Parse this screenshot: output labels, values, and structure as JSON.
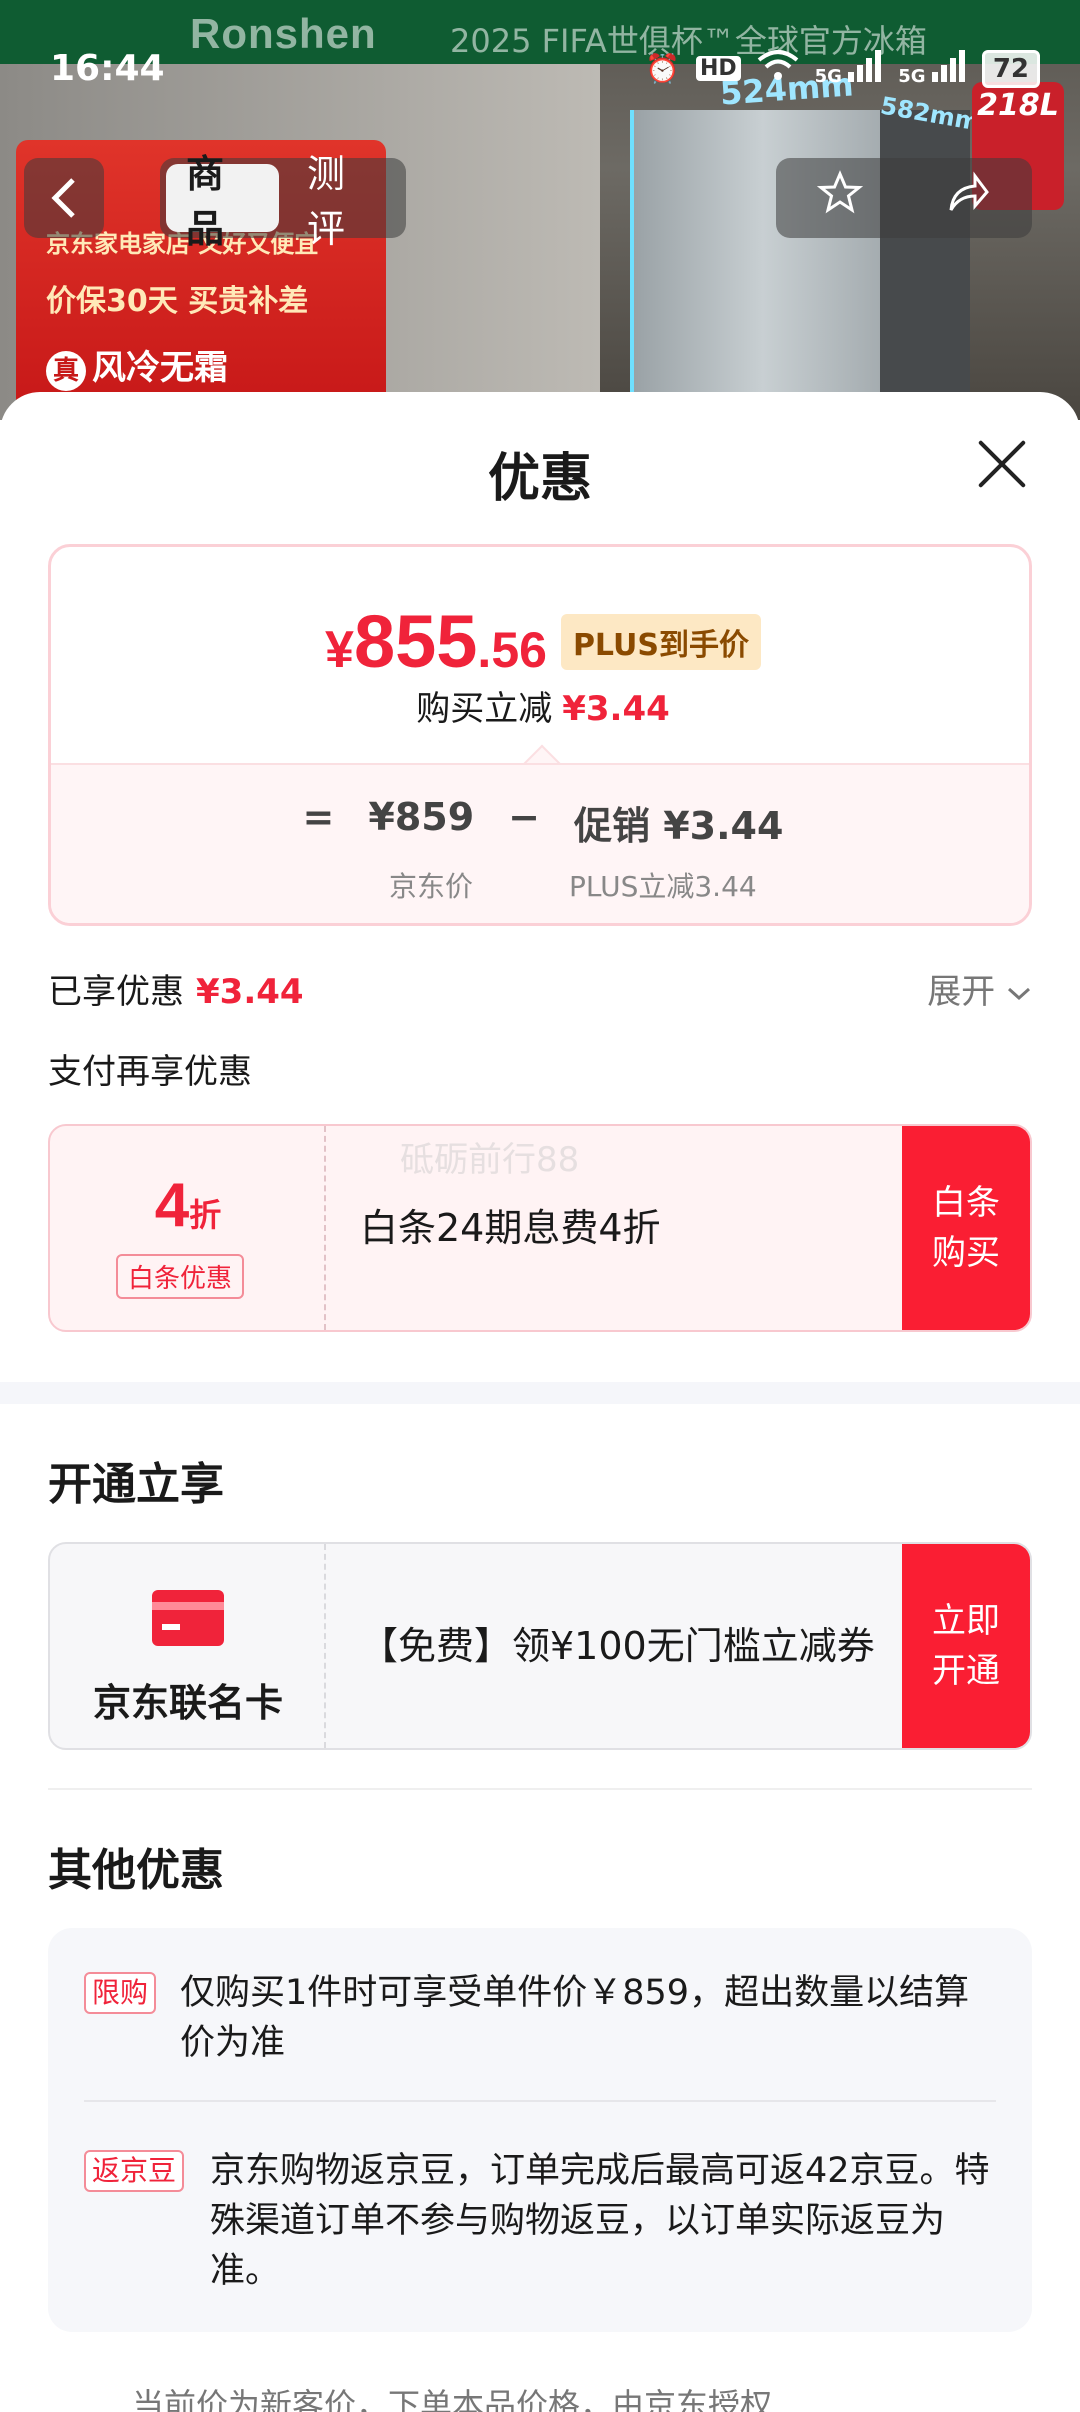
{
  "status_bar": {
    "time": "16:44",
    "battery": "72",
    "network1": "5G",
    "network2": "5G",
    "hd": "HD"
  },
  "backdrop": {
    "brand": "Ronshen",
    "banner": "2025 FIFA世俱杯™全球官方冰箱",
    "dimension_width": "524mm",
    "dimension_depth": "582mm",
    "capacity": "218L",
    "promo_store": "京东家电家店 又好又便宜",
    "promo_guarantee": "价保30天 买贵补差",
    "promo_feature": "风冷无霜",
    "promo_feature_badge": "真"
  },
  "nav": {
    "back_icon": "chevron-left-icon",
    "tabs": [
      {
        "label": "商品",
        "active": true
      },
      {
        "label": "测评",
        "active": false
      }
    ],
    "favorite_icon": "star-icon",
    "share_icon": "share-icon"
  },
  "sheet": {
    "title": "优惠",
    "close_icon": "close-icon",
    "price_card": {
      "currency": "¥",
      "price_int": "855",
      "price_dec": ".56",
      "plus_tag": "PLUS到手价",
      "reduce_label": "购买立减",
      "reduce_value": "¥3.44",
      "eq": "=",
      "jd_price": "¥859",
      "minus": "−",
      "promo_value": "促销 ¥3.44",
      "jd_price_label": "京东价",
      "promo_label": "PLUS立减3.44"
    },
    "enjoyed_label": "已享优惠",
    "enjoyed_value": "¥3.44",
    "expand_label": "展开",
    "pay_title": "支付再享优惠",
    "baitiao": {
      "discount_num": "4",
      "discount_unit": "折",
      "tag": "白条优惠",
      "desc": "白条24期息费4折",
      "button_line1": "白条",
      "button_line2": "购买",
      "watermark": "砥砺前行88"
    },
    "open_title": "开通立享",
    "card": {
      "label": "京东联名卡",
      "desc": "【免费】领¥100无门槛立减券",
      "button_line1": "立即",
      "button_line2": "开通"
    },
    "other_title": "其他优惠",
    "other_items": [
      {
        "tag": "限购",
        "text": "仅购买1件时可享受单件价￥859，超出数量以结算价为准"
      },
      {
        "tag": "返京豆",
        "text": "京东购物返京豆，订单完成后最高可返42京豆。特殊渠道订单不参与购物返豆，以订单实际返豆为准。"
      }
    ],
    "footer_note": "…当前价为新客价，下单本品价格，由京东授权"
  },
  "colors": {
    "accent_red": "#f0233a",
    "button_red": "#fa1e33",
    "plus_gold": "#fde8c4"
  }
}
